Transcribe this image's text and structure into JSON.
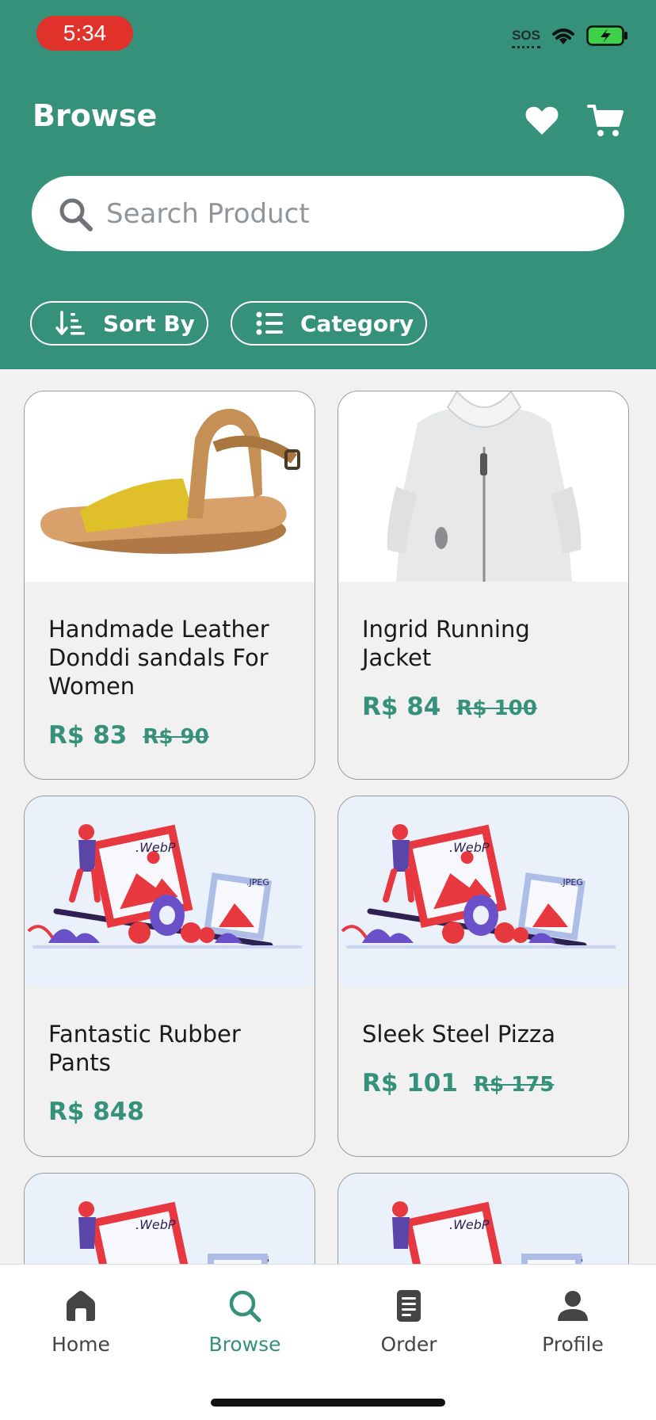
{
  "status_bar": {
    "time": "5:34",
    "sos": "SOS"
  },
  "header": {
    "title": "Browse"
  },
  "search": {
    "placeholder": "Search Product"
  },
  "chips": {
    "sort_label": "Sort By",
    "category_label": "Category"
  },
  "products": [
    {
      "name": "Handmade Leather Donddi sandals For Women",
      "price": "R$ 83",
      "old_price": "R$ 90"
    },
    {
      "name": "Ingrid Running Jacket",
      "price": "R$ 84",
      "old_price": "R$ 100"
    },
    {
      "name": "Fantastic Rubber Pants",
      "price": "R$ 848",
      "old_price": ""
    },
    {
      "name": "Sleek Steel Pizza",
      "price": "R$ 101",
      "old_price": "R$ 175"
    }
  ],
  "placeholder_image": {
    "label_webp": ".WebP",
    "label_jpeg": ".JPEG"
  },
  "nav": [
    {
      "label": "Home",
      "icon": "home-icon"
    },
    {
      "label": "Browse",
      "icon": "search-icon"
    },
    {
      "label": "Order",
      "icon": "document-icon"
    },
    {
      "label": "Profile",
      "icon": "user-icon"
    }
  ],
  "colors": {
    "primary": "#35917a",
    "time_pill": "#e0312b"
  }
}
